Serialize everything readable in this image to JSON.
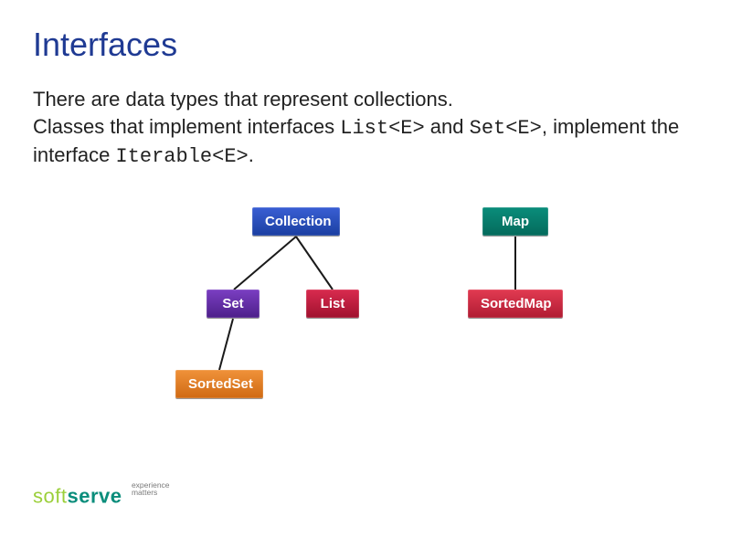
{
  "title": "Interfaces",
  "paragraphs": {
    "p1": "There are data types that represent collections.",
    "p2_prefix": "Classes that implement interfaces ",
    "p2_code1": "List<E>",
    "p2_mid": " and ",
    "p2_code2": "Set<E>",
    "p2_suffix": ", implement the interface ",
    "p2_code3": "Iterable<E>",
    "p2_end": "."
  },
  "diagram": {
    "collection": "Collection",
    "map": "Map",
    "set": "Set",
    "list": "List",
    "sortedmap": "SortedMap",
    "sortedset": "SortedSet"
  },
  "footer": {
    "brand1": "soft",
    "brand2": "serve",
    "tagline1": "experience",
    "tagline2": "matters"
  }
}
